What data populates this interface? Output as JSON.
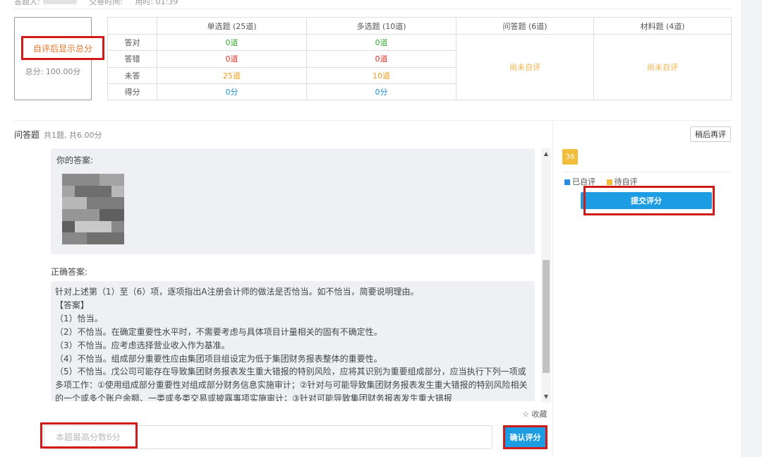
{
  "topline": {
    "label_a": "答题人:",
    "label_b": "交卷时间:",
    "label_c": "用时: 01:39"
  },
  "score_card": {
    "headline": "自评后显示总分",
    "total": "总分: 100.00分"
  },
  "stats_table": {
    "headers": [
      "单选题 (25道)",
      "多选题 (10道)",
      "问答题 (6道)",
      "材料题 (4道)"
    ],
    "rows": [
      {
        "label": "答对",
        "single": "0道",
        "multi": "0道"
      },
      {
        "label": "答错",
        "single": "0道",
        "multi": "0道"
      },
      {
        "label": "未答",
        "single": "25道",
        "multi": "10道"
      },
      {
        "label": "得分",
        "single": "0分",
        "multi": "0分"
      }
    ],
    "qa_status": "尚未自评",
    "material_status": "尚未自评"
  },
  "section": {
    "title": "问答题",
    "subtitle": "共1题, 共6.00分"
  },
  "right_panel": {
    "later_button": "稍后再评",
    "question_number": "36",
    "legend": [
      "已自评",
      "待自评"
    ],
    "submit_button": "提交评分"
  },
  "answer": {
    "your_answer_label": "你的答案:",
    "correct_label": "正确答案:",
    "lines": [
      "针对上述第（1）至（6）项，逐项指出A注册会计师的做法是否恰当。如不恰当，简要说明理由。",
      "【答案】",
      "（1）恰当。",
      "（2）不恰当。在确定重要性水平时，不需要考虑与具体项目计量相关的固有不确定性。",
      "（3）不恰当。应考虑选择营业收入作为基准。",
      "（4）不恰当。组成部分重要性应由集团项目组设定为低于集团财务报表整体的重要性。",
      "（5）不恰当。戊公司可能存在导致集团财务报表发生重大错报的特别风险，应将其识别为重要组成部分，应当执行下列一项或多项工作：①使用组成部分重要性对组成部分财务信息实施审计；②针对与可能导致集团财务报表发生重大错报的特别风险相关的一个或多个账户余额、一类或多类交易或披露事项实施审计；③针对可能导致集团财务报表发生重大错报"
    ]
  },
  "footer": {
    "favorite": "收藏",
    "score_placeholder": "本题最高分数6分",
    "confirm_button": "确认评分"
  },
  "colors": {
    "accent": "#1c9de3",
    "highlight_box": "#d11a1a",
    "pending": "#f2b24a",
    "reviewed_legend": "#2b8be0",
    "pending_legend": "#f3bd3c"
  }
}
